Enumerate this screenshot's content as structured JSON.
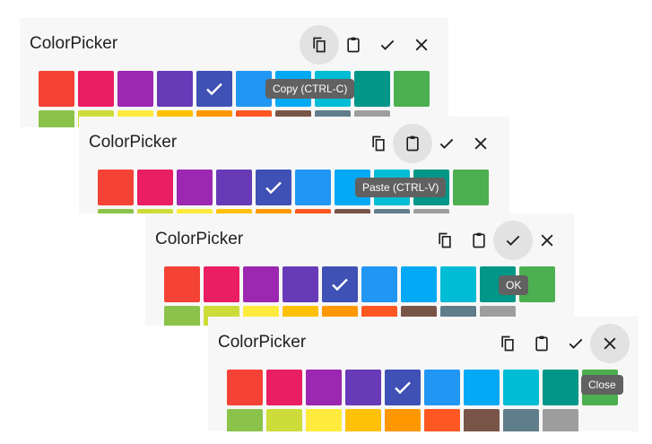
{
  "title": "ColorPicker",
  "colors": [
    "#f44336",
    "#e91e63",
    "#9c27b0",
    "#673ab7",
    "#3f51b5",
    "#2196f3",
    "#03a9f4",
    "#00bcd4",
    "#009688",
    "#4caf50",
    "#8bc34a",
    "#cddc39",
    "#ffeb3b",
    "#ffc107",
    "#ff9800",
    "#ff5722",
    "#795548",
    "#607d8b",
    "#9e9e9e"
  ],
  "selected_index": 4,
  "panels": [
    {
      "tooltip": "Copy (CTRL-C)",
      "hovered": "copy"
    },
    {
      "tooltip": "Paste (CTRL-V)",
      "hovered": "paste"
    },
    {
      "tooltip": "OK",
      "hovered": "ok"
    },
    {
      "tooltip": "Close",
      "hovered": "close"
    }
  ],
  "icons": {
    "copy": "copy-icon",
    "paste": "paste-icon",
    "ok": "check-icon",
    "close": "close-icon",
    "selected": "check-icon"
  }
}
